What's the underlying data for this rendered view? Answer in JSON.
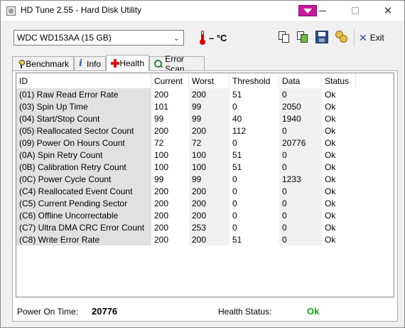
{
  "window": {
    "title": "HD Tune 2.55 - Hard Disk Utility"
  },
  "toolbar": {
    "drive": "WDC WD153AA (15 GB)",
    "temperature": "– °C",
    "exit_label": "Exit",
    "icons": [
      "copy-text-icon",
      "copy-screenshot-icon",
      "save-icon",
      "multi-disk-icon",
      "exit-icon"
    ]
  },
  "tabs": [
    {
      "label": "Benchmark",
      "icon": "benchmark-icon"
    },
    {
      "label": "Info",
      "icon": "info-icon"
    },
    {
      "label": "Health",
      "icon": "health-icon",
      "active": true
    },
    {
      "label": "Error Scan",
      "icon": "error-scan-icon"
    }
  ],
  "table": {
    "columns": [
      "ID",
      "Current",
      "Worst",
      "Threshold",
      "Data",
      "Status"
    ],
    "rows": [
      [
        "(01) Raw Read Error Rate",
        "200",
        "200",
        "51",
        "0",
        "Ok"
      ],
      [
        "(03) Spin Up Time",
        "101",
        "99",
        "0",
        "2050",
        "Ok"
      ],
      [
        "(04) Start/Stop Count",
        "99",
        "99",
        "40",
        "1940",
        "Ok"
      ],
      [
        "(05) Reallocated Sector Count",
        "200",
        "200",
        "112",
        "0",
        "Ok"
      ],
      [
        "(09) Power On Hours Count",
        "72",
        "72",
        "0",
        "20776",
        "Ok"
      ],
      [
        "(0A) Spin Retry Count",
        "100",
        "100",
        "51",
        "0",
        "Ok"
      ],
      [
        "(0B) Calibration Retry Count",
        "100",
        "100",
        "51",
        "0",
        "Ok"
      ],
      [
        "(0C) Power Cycle Count",
        "99",
        "99",
        "0",
        "1233",
        "Ok"
      ],
      [
        "(C4) Reallocated Event Count",
        "200",
        "200",
        "0",
        "0",
        "Ok"
      ],
      [
        "(C5) Current Pending Sector",
        "200",
        "200",
        "0",
        "0",
        "Ok"
      ],
      [
        "(C6) Offline Uncorrectable",
        "200",
        "200",
        "0",
        "0",
        "Ok"
      ],
      [
        "(C7) Ultra DMA CRC Error Count",
        "200",
        "253",
        "0",
        "0",
        "Ok"
      ],
      [
        "(C8) Write Error Rate",
        "200",
        "200",
        "51",
        "0",
        "Ok"
      ]
    ]
  },
  "footer": {
    "power_on_label": "Power On Time:",
    "power_on_value": "20776",
    "health_label": "Health Status:",
    "health_value": "Ok",
    "health_color": "#16a016"
  }
}
